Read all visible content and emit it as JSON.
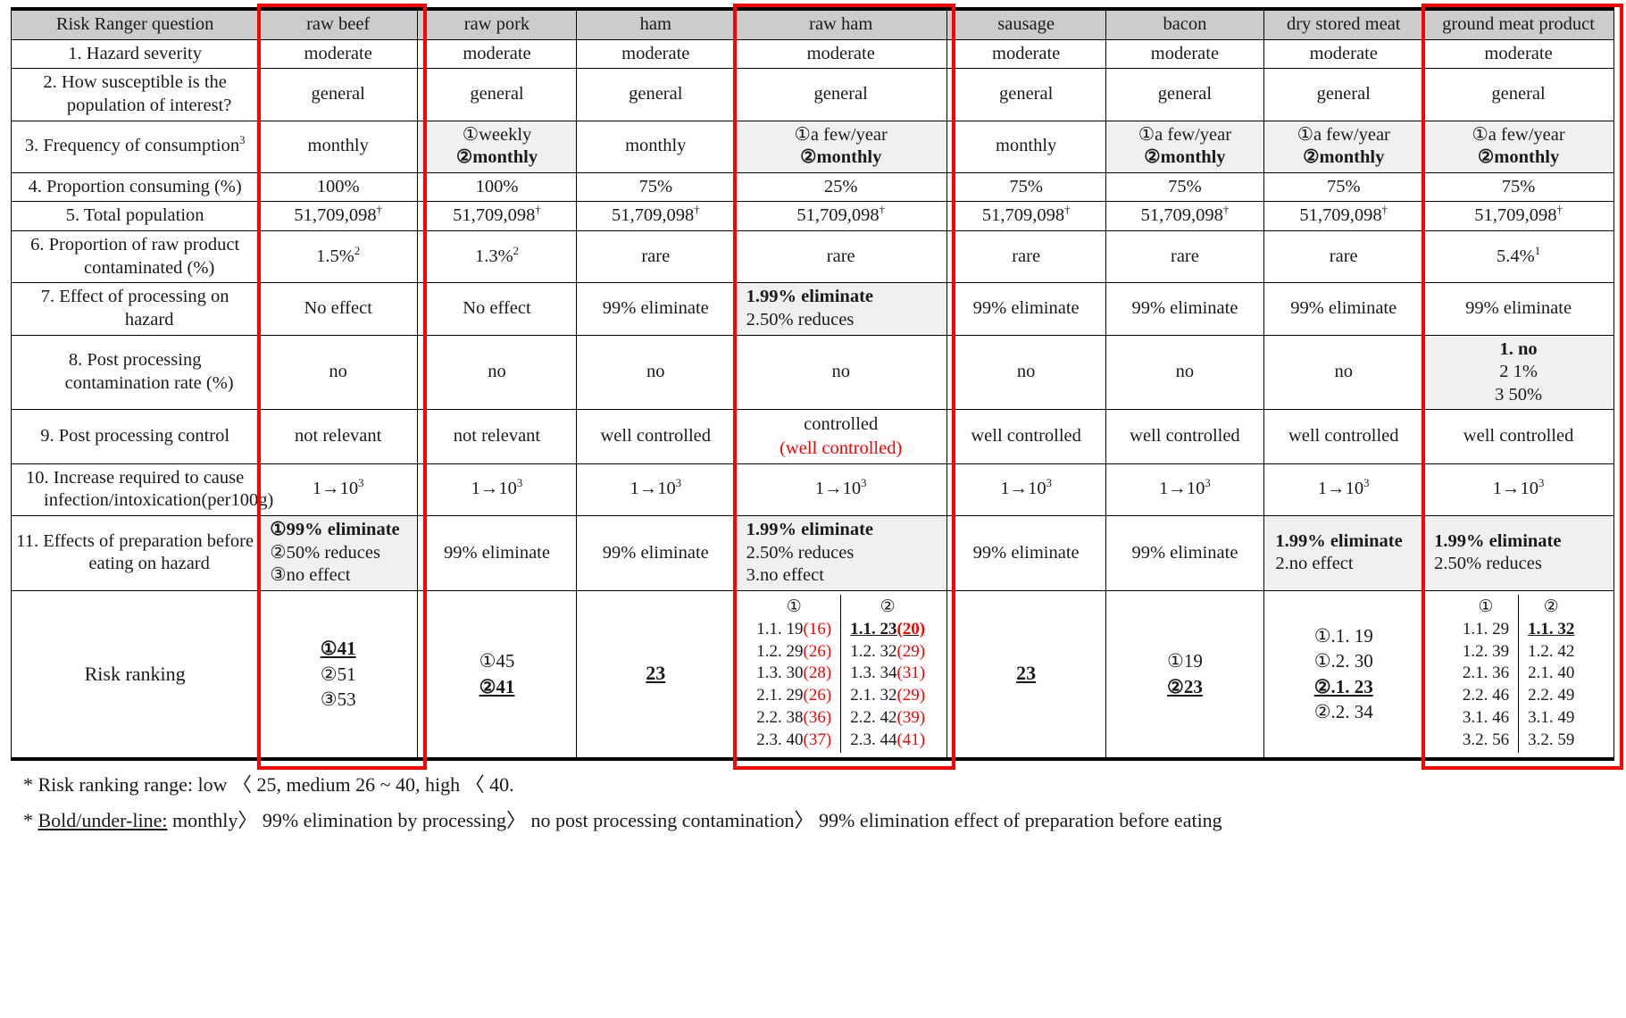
{
  "table": {
    "columns": [
      {
        "id": "question",
        "label": "Risk Ranger question",
        "highlight": false
      },
      {
        "id": "raw_beef",
        "label": "raw beef",
        "highlight": true
      },
      {
        "id": "raw_pork",
        "label": "raw pork",
        "highlight": false
      },
      {
        "id": "ham",
        "label": "ham",
        "highlight": false
      },
      {
        "id": "raw_ham",
        "label": "raw ham",
        "highlight": true
      },
      {
        "id": "sausage",
        "label": "sausage",
        "highlight": false
      },
      {
        "id": "bacon",
        "label": "bacon",
        "highlight": false
      },
      {
        "id": "dry_stored_meat",
        "label": "dry stored meat",
        "highlight": false
      },
      {
        "id": "ground_meat_product",
        "label": "ground meat product",
        "highlight": true
      }
    ],
    "rows": [
      {
        "question": "1. Hazard severity",
        "cells": [
          "moderate",
          "moderate",
          "moderate",
          "moderate",
          "moderate",
          "moderate",
          "moderate",
          "moderate"
        ]
      },
      {
        "question": "2. How susceptible is the population of interest?",
        "cells": [
          "general",
          "general",
          "general",
          "general",
          "general",
          "general",
          "general",
          "general"
        ]
      },
      {
        "question": "3. Frequency of consumption",
        "question_sup": "3",
        "cells": [
          "monthly",
          "①weekly\n②monthly",
          "monthly",
          "①a few/year\n②monthly",
          "monthly",
          "①a few/year\n②monthly",
          "①a few/year\n②monthly",
          "①a few/year\n②monthly"
        ]
      },
      {
        "question": "4. Proportion consuming (%)",
        "cells": [
          "100%",
          "100%",
          "75%",
          "25%",
          "75%",
          "75%",
          "75%",
          "75%"
        ]
      },
      {
        "question": "5. Total population",
        "cells": [
          "51,709,098",
          "51,709,098",
          "51,709,098",
          "51,709,098",
          "51,709,098",
          "51,709,098",
          "51,709,098",
          "51,709,098"
        ],
        "cells_sup": "†"
      },
      {
        "question": "6. Proportion of raw product contaminated (%)",
        "cells": [
          "1.5%",
          "1.3%",
          "rare",
          "rare",
          "rare",
          "rare",
          "rare",
          "5.4%"
        ],
        "cells_sup_map": {
          "0": "2",
          "1": "2",
          "7": "1"
        }
      },
      {
        "question": "7. Effect of processing on hazard",
        "cells": [
          "No effect",
          "No effect",
          "99% eliminate",
          "1.99% eliminate\n2.50% reduces",
          "99% eliminate",
          "99% eliminate",
          "99% eliminate",
          "99% eliminate"
        ]
      },
      {
        "question": "8. Post processing contamination rate (%)",
        "cells": [
          "no",
          "no",
          "no",
          "no",
          "no",
          "no",
          "no",
          "1. no\n2 1%\n3 50%"
        ]
      },
      {
        "question": "9. Post processing control",
        "cells": [
          "not relevant",
          "not relevant",
          "well controlled",
          "controlled",
          "well controlled",
          "well controlled",
          "well controlled",
          "well controlled"
        ],
        "raw_ham_red_note": "(well controlled)"
      },
      {
        "question": "10. Increase required to cause infection/intoxication(per100g)",
        "cells": [
          "1→10",
          "1→10",
          "1→10",
          "1→10",
          "1→10",
          "1→10",
          "1→10",
          "1→10"
        ],
        "cells_sup": "3"
      },
      {
        "question": "11. Effects of preparation before eating on hazard",
        "cells": [
          "①99% eliminate\n②50% reduces\n③no effect",
          "99% eliminate",
          "99% eliminate",
          "1.99% eliminate\n2.50% reduces\n3.no effect",
          "99% eliminate",
          "99% eliminate",
          "1.99% eliminate\n2.no effect",
          "1.99% eliminate\n2.50% reduces"
        ]
      }
    ],
    "risk_ranking": {
      "label": "Risk ranking",
      "raw_beef": {
        "type": "list",
        "items": [
          {
            "text": "①41",
            "bold": true,
            "underline": true
          },
          {
            "text": "②51"
          },
          {
            "text": "③53"
          }
        ]
      },
      "raw_pork": {
        "type": "list",
        "items": [
          {
            "text": "①45"
          },
          {
            "text": "②41",
            "bold": true,
            "underline": true
          }
        ]
      },
      "ham": {
        "type": "single",
        "text": "23",
        "bold": true,
        "underline": true
      },
      "raw_ham": {
        "type": "split",
        "groups": [
          {
            "header": "①",
            "rows": [
              {
                "label": "1.1.",
                "value": "19",
                "paren": "16"
              },
              {
                "label": "1.2.",
                "value": "29",
                "paren": "26"
              },
              {
                "label": "1.3.",
                "value": "30",
                "paren": "28"
              },
              {
                "label": "2.1.",
                "value": "29",
                "paren": "26"
              },
              {
                "label": "2.2.",
                "value": "38",
                "paren": "36"
              },
              {
                "label": "2.3.",
                "value": "40",
                "paren": "37"
              }
            ]
          },
          {
            "header": "②",
            "rows": [
              {
                "label": "1.1.",
                "value": "23",
                "paren": "20",
                "bold": true,
                "underline": true
              },
              {
                "label": "1.2.",
                "value": "32",
                "paren": "29"
              },
              {
                "label": "1.3.",
                "value": "34",
                "paren": "31"
              },
              {
                "label": "2.1.",
                "value": "32",
                "paren": "29"
              },
              {
                "label": "2.2.",
                "value": "42",
                "paren": "39"
              },
              {
                "label": "2.3.",
                "value": "44",
                "paren": "41"
              }
            ]
          }
        ]
      },
      "sausage": {
        "type": "single",
        "text": "23",
        "bold": true,
        "underline": true
      },
      "bacon": {
        "type": "list",
        "items": [
          {
            "text": "①19"
          },
          {
            "text": "②23",
            "bold": true,
            "underline": true
          }
        ]
      },
      "dry_stored_meat": {
        "type": "list",
        "items": [
          {
            "text": "①.1. 19"
          },
          {
            "text": "①.2. 30"
          },
          {
            "text": "②.1. 23",
            "bold": true,
            "underline": true
          },
          {
            "text": "②.2. 34"
          }
        ]
      },
      "ground_meat_product": {
        "type": "split",
        "groups": [
          {
            "header": "①",
            "rows": [
              {
                "label": "1.1.",
                "value": "29"
              },
              {
                "label": "1.2.",
                "value": "39"
              },
              {
                "label": "2.1.",
                "value": "36"
              },
              {
                "label": "2.2.",
                "value": "46"
              },
              {
                "label": "3.1.",
                "value": "46"
              },
              {
                "label": "3.2.",
                "value": "56"
              }
            ]
          },
          {
            "header": "②",
            "rows": [
              {
                "label": "1.1.",
                "value": "32",
                "bold": true,
                "underline": true
              },
              {
                "label": "1.2.",
                "value": "42"
              },
              {
                "label": "2.1.",
                "value": "40"
              },
              {
                "label": "2.2.",
                "value": "49"
              },
              {
                "label": "3.1.",
                "value": "49"
              },
              {
                "label": "3.2.",
                "value": "59"
              }
            ]
          }
        ]
      }
    }
  },
  "notes": {
    "note1": "* Risk ranking range: low 〈 25, medium 26 ~ 40, high 〈 40.",
    "note2_star": "*",
    "note2_label": "Bold/under-line:",
    "note2_body": " monthly〉 99% elimination by processing〉 no post processing contamination〉 99% elimination effect of preparation before eating"
  },
  "colors": {
    "highlight": "#ff0000",
    "header_bg": "#cccccc",
    "shade_bg": "#f0f0f0"
  }
}
